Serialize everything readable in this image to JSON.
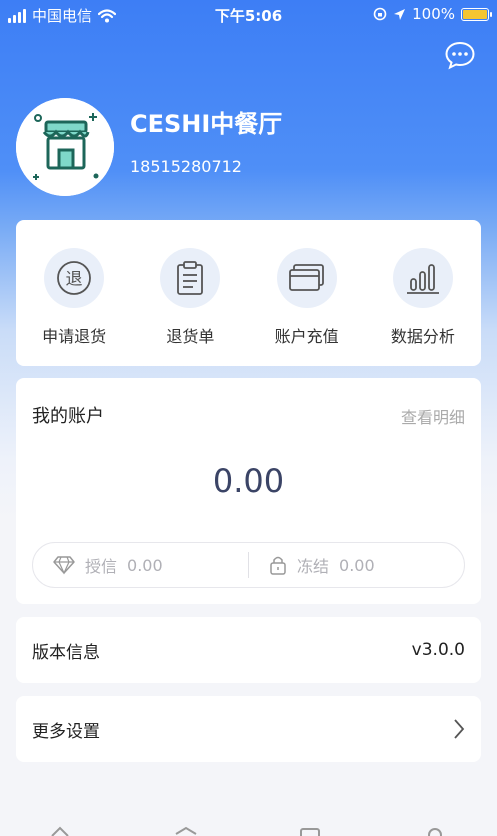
{
  "status_bar": {
    "carrier": "中国电信",
    "time": "下午5:06",
    "battery": "100%"
  },
  "profile": {
    "shop_name": "CESHI中餐厅",
    "phone": "18515280712"
  },
  "actions": [
    {
      "label": "申请退货",
      "icon": "return-circle-icon",
      "glyph": "退"
    },
    {
      "label": "退货单",
      "icon": "clipboard-icon"
    },
    {
      "label": "账户充值",
      "icon": "cards-icon"
    },
    {
      "label": "数据分析",
      "icon": "bar-chart-icon"
    }
  ],
  "account": {
    "title": "我的账户",
    "detail_link": "查看明细",
    "balance": "0.00",
    "credit_label": "授信",
    "credit_value": "0.00",
    "frozen_label": "冻结",
    "frozen_value": "0.00"
  },
  "version": {
    "label": "版本信息",
    "value": "v3.0.0"
  },
  "settings": {
    "label": "更多设置"
  },
  "colors": {
    "primary": "#3d7ef5",
    "balance": "#3b4466",
    "muted": "#aaaaaa",
    "battery": "#f5c531"
  }
}
